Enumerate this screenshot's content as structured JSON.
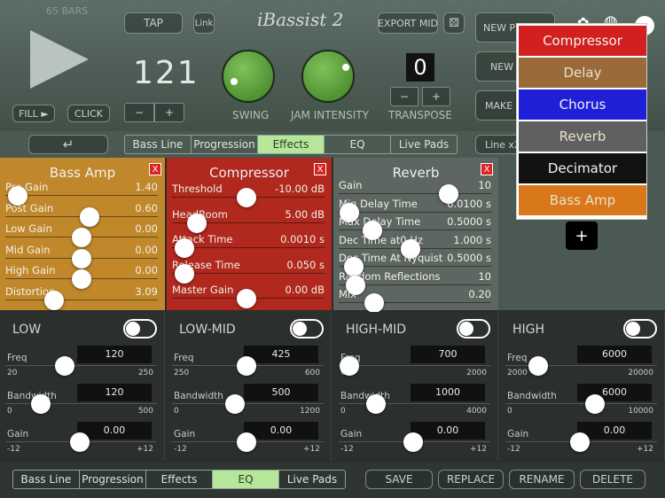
{
  "header": {
    "bars": "65 BARS",
    "tap": "TAP",
    "link": "Link",
    "logo": "iBassist 2",
    "export_mid": "EXPORT MID",
    "new_progression": "NEW PROGR",
    "new": "NEW",
    "make": "MAKE I",
    "tempo": "121",
    "fill": "FILL ►",
    "click": "CLICK",
    "minus": "−",
    "plus": "+",
    "swing_label": "SWING",
    "jam_label": "JAM INTENSITY",
    "transpose_value": "0",
    "transpose_label": "TRANSPOSE",
    "transpose_minus": "−",
    "transpose_plus": "+"
  },
  "tabs_top": {
    "back": "↵",
    "items": [
      "Bass Line",
      "Progression",
      "Effects",
      "EQ",
      "Live Pads"
    ],
    "selected": "Effects",
    "line": "Line x2"
  },
  "bass_amp": {
    "title": "Bass Amp",
    "close": "X",
    "params": [
      {
        "label": "Pre Gain",
        "value": "1.40",
        "level": 0.08
      },
      {
        "label": "Post Gain",
        "value": "0.60",
        "level": 0.55
      },
      {
        "label": "Low Gain",
        "value": "0.00",
        "level": 0.5
      },
      {
        "label": "Mid Gain",
        "value": "0.00",
        "level": 0.5
      },
      {
        "label": "High Gain",
        "value": "0.00",
        "level": 0.5
      },
      {
        "label": "Distortion",
        "value": "3.09",
        "level": 0.32
      }
    ]
  },
  "compressor": {
    "title": "Compressor",
    "close": "X",
    "params": [
      {
        "label": "Threshold",
        "value": "-10.00 dB",
        "level": 0.49
      },
      {
        "label": "HeadRoom",
        "value": "5.00 dB",
        "level": 0.16
      },
      {
        "label": "Attack Time",
        "value": "0.0010 s",
        "level": 0.08
      },
      {
        "label": "Release Time",
        "value": "0.050 s",
        "level": 0.08
      },
      {
        "label": "Master Gain",
        "value": "0.00 dB",
        "level": 0.49
      }
    ]
  },
  "reverb": {
    "title": "Reverb",
    "close": "X",
    "params": [
      {
        "label": "Gain",
        "value": "10",
        "level": 0.72
      },
      {
        "label": "Min Delay Time",
        "value": "0.0100 s",
        "level": 0.07
      },
      {
        "label": "Max Delay Time",
        "value": "0.5000 s",
        "level": 0.22
      },
      {
        "label": "Dec Time at0 Hz",
        "value": "1.000 s",
        "level": 0.47
      },
      {
        "label": "Dec Time At Nyquist",
        "value": "0.5000 s",
        "level": 0.1
      },
      {
        "label": "Random Reflections",
        "value": "10",
        "level": 0.11
      },
      {
        "label": "Mix",
        "value": "0.20",
        "level": 0.23
      }
    ]
  },
  "effect_menu": {
    "items": [
      {
        "label": "Compressor",
        "color": "#d21f1f"
      },
      {
        "label": "Delay",
        "color": "#9b6a3a"
      },
      {
        "label": "Chorus",
        "color": "#1f1fd8"
      },
      {
        "label": "Reverb",
        "color": "#606060"
      },
      {
        "label": "Decimator",
        "color": "#121212"
      },
      {
        "label": "Bass Amp",
        "color": "#d8781a"
      }
    ],
    "add": "+"
  },
  "eq": {
    "bands": [
      {
        "title": "LOW",
        "freq": {
          "label": "Freq",
          "value": "120",
          "min": "20",
          "max": "250",
          "level": 0.4
        },
        "bandwidth": {
          "label": "Bandwidth",
          "value": "120",
          "min": "0",
          "max": "500",
          "level": 0.24
        },
        "gain": {
          "label": "Gain",
          "value": "0.00",
          "min": "-12",
          "max": "+12",
          "level": 0.5
        }
      },
      {
        "title": "LOW-MID",
        "freq": {
          "label": "Freq",
          "value": "425",
          "min": "250",
          "max": "600",
          "level": 0.5
        },
        "bandwidth": {
          "label": "Bandwidth",
          "value": "500",
          "min": "0",
          "max": "1200",
          "level": 0.42
        },
        "gain": {
          "label": "Gain",
          "value": "0.00",
          "min": "-12",
          "max": "+12",
          "level": 0.5
        }
      },
      {
        "title": "HIGH-MID",
        "freq": {
          "label": "Freq",
          "value": "700",
          "min": "600",
          "max": "2000",
          "level": 0.07
        },
        "bandwidth": {
          "label": "Bandwidth",
          "value": "1000",
          "min": "0",
          "max": "4000",
          "level": 0.25
        },
        "gain": {
          "label": "Gain",
          "value": "0.00",
          "min": "-12",
          "max": "+12",
          "level": 0.5
        }
      },
      {
        "title": "HIGH",
        "freq": {
          "label": "Freq",
          "value": "6000",
          "min": "2000",
          "max": "20000",
          "level": 0.22
        },
        "bandwidth": {
          "label": "Bandwidth",
          "value": "6000",
          "min": "0",
          "max": "10000",
          "level": 0.6
        },
        "gain": {
          "label": "Gain",
          "value": "0.00",
          "min": "-12",
          "max": "+12",
          "level": 0.5
        }
      }
    ]
  },
  "bottom": {
    "tabs": [
      "Bass Line",
      "Progression",
      "Effects",
      "EQ",
      "Live Pads"
    ],
    "selected": "EQ",
    "save": "SAVE",
    "replace": "REPLACE",
    "rename": "RENAME",
    "delete": "DELETE"
  }
}
